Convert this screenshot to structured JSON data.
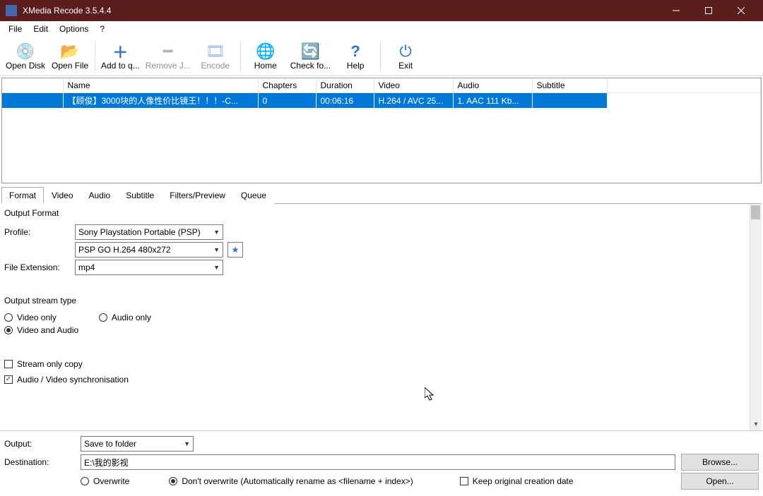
{
  "window": {
    "title": "XMedia Recode 3.5.4.4"
  },
  "menu": {
    "file": "File",
    "edit": "Edit",
    "options": "Options",
    "help": "?"
  },
  "toolbar": {
    "open_disk": "Open Disk",
    "open_file": "Open File",
    "add_to_queue": "Add to q...",
    "remove_job": "Remove J...",
    "encode": "Encode",
    "home": "Home",
    "check_update": "Check fo...",
    "help": "Help",
    "exit": "Exit"
  },
  "grid": {
    "headers": {
      "blank": "",
      "name": "Name",
      "chapters": "Chapters",
      "duration": "Duration",
      "video": "Video",
      "audio": "Audio",
      "subtitle": "Subtitle"
    },
    "rows": [
      {
        "name": "【顾俊】3000块的人像性价比镜王！！！-C...",
        "chapters": "0",
        "duration": "00:06:16",
        "video": "H.264 / AVC  25...",
        "audio": "1. AAC  111 Kb...",
        "subtitle": ""
      }
    ]
  },
  "tabs": {
    "format": "Format",
    "video": "Video",
    "audio": "Audio",
    "subtitle": "Subtitle",
    "filters": "Filters/Preview",
    "queue": "Queue"
  },
  "format": {
    "output_format_label": "Output Format",
    "profile_label": "Profile:",
    "profile_value": "Sony Playstation Portable (PSP)",
    "preset_value": "PSP GO H.264 480x272",
    "file_ext_label": "File Extension:",
    "file_ext_value": "mp4",
    "stream_type_label": "Output stream type",
    "video_only": "Video only",
    "audio_only": "Audio only",
    "video_and_audio": "Video and Audio",
    "stream_only_copy": "Stream only copy",
    "av_sync": "Audio / Video synchronisation"
  },
  "output": {
    "output_label": "Output:",
    "output_mode": "Save to folder",
    "destination_label": "Destination:",
    "destination_value": "E:\\我的影视",
    "browse_btn": "Browse...",
    "open_btn": "Open...",
    "overwrite": "Overwrite",
    "dont_overwrite": "Don't overwrite (Automatically rename as <filename + index>)",
    "keep_date": "Keep original creation date"
  }
}
